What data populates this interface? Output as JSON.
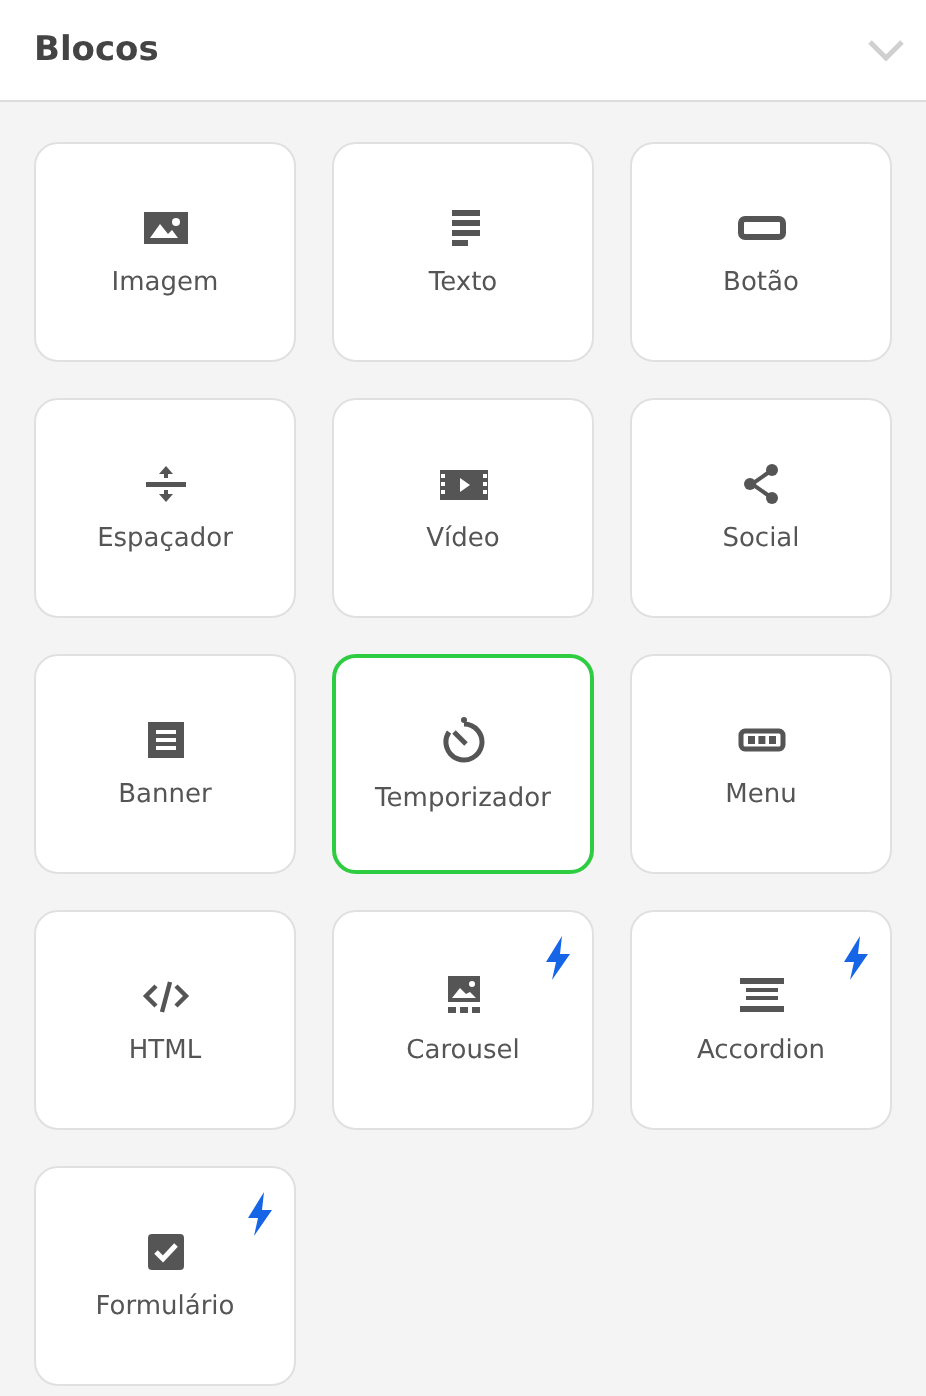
{
  "panel": {
    "title": "Blocos",
    "expanded": true
  },
  "blocks": [
    {
      "kind": "image",
      "label": "Imagem",
      "selected": false,
      "premium": false
    },
    {
      "kind": "text",
      "label": "Texto",
      "selected": false,
      "premium": false
    },
    {
      "kind": "button",
      "label": "Botão",
      "selected": false,
      "premium": false
    },
    {
      "kind": "spacer",
      "label": "Espaçador",
      "selected": false,
      "premium": false
    },
    {
      "kind": "video",
      "label": "Vídeo",
      "selected": false,
      "premium": false
    },
    {
      "kind": "social",
      "label": "Social",
      "selected": false,
      "premium": false
    },
    {
      "kind": "banner",
      "label": "Banner",
      "selected": false,
      "premium": false
    },
    {
      "kind": "timer",
      "label": "Temporizador",
      "selected": true,
      "premium": false
    },
    {
      "kind": "menu",
      "label": "Menu",
      "selected": false,
      "premium": false
    },
    {
      "kind": "html",
      "label": "HTML",
      "selected": false,
      "premium": false
    },
    {
      "kind": "carousel",
      "label": "Carousel",
      "selected": false,
      "premium": true
    },
    {
      "kind": "accordion",
      "label": "Accordion",
      "selected": false,
      "premium": true
    },
    {
      "kind": "form",
      "label": "Formulário",
      "selected": false,
      "premium": true
    }
  ]
}
